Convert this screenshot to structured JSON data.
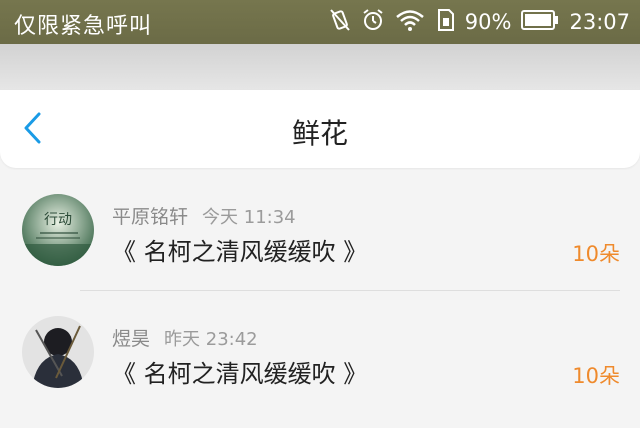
{
  "status": {
    "carrier": "仅限紧急呼叫",
    "battery": "90%",
    "time": "23:07"
  },
  "header": {
    "title": "鲜花"
  },
  "items": [
    {
      "name": "平原铭轩",
      "time": "今天 11:34",
      "work": "《 名柯之清风缓缓吹 》",
      "count": "10朵",
      "avatar_text": "行动"
    },
    {
      "name": "煜昊",
      "time": "昨天 23:42",
      "work": "《 名柯之清风缓缓吹 》",
      "count": "10朵"
    }
  ],
  "colors": {
    "accent": "#1a9be6",
    "count": "#ef8a2c"
  }
}
